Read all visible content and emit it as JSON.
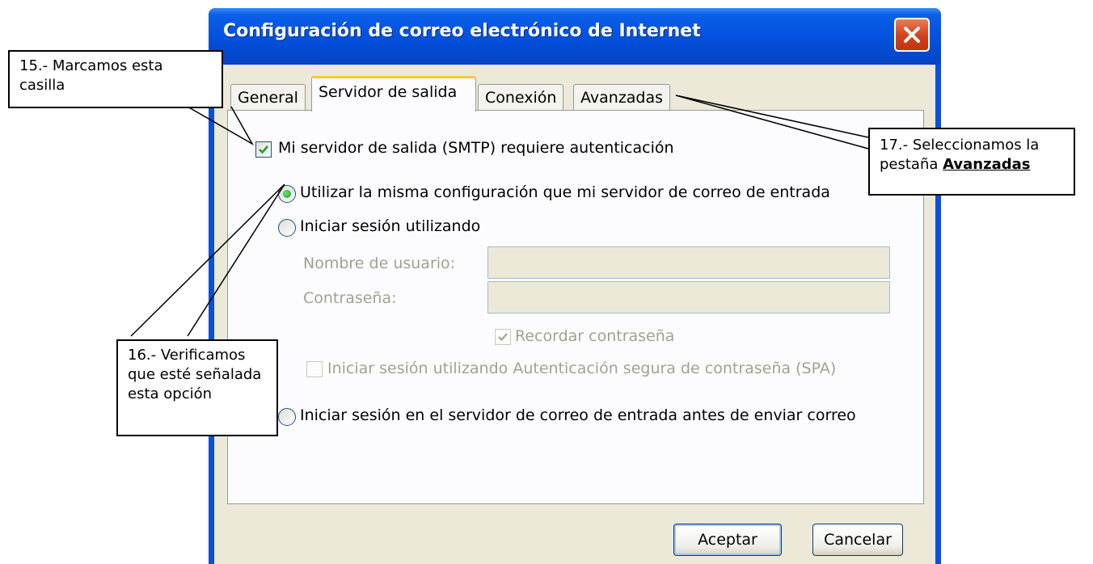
{
  "window": {
    "title": "Configuración de correo electrónico de Internet"
  },
  "tabs": [
    {
      "label": "General"
    },
    {
      "label": "Servidor de salida",
      "active": true
    },
    {
      "label": "Conexión"
    },
    {
      "label": "Avanzadas"
    }
  ],
  "smtp_auth": {
    "label": "Mi servidor de salida (SMTP) requiere autenticación",
    "checked": true
  },
  "options": {
    "same_config": {
      "label": "Utilizar la misma configuración que mi servidor de correo de entrada",
      "selected": true
    },
    "login_using": {
      "label": "Iniciar sesión utilizando",
      "selected": false
    },
    "login_before": {
      "label": "Iniciar sesión en el servidor de correo de entrada antes de enviar correo",
      "selected": false
    }
  },
  "fields": {
    "username_label": "Nombre de usuario:",
    "username_value": "",
    "password_label": "Contraseña:",
    "password_value": "",
    "remember_label": "Recordar contraseña",
    "remember_checked": true,
    "spa_label": "Iniciar sesión utilizando Autenticación segura de contraseña (SPA)",
    "spa_checked": false
  },
  "buttons": {
    "ok": "Aceptar",
    "cancel": "Cancelar"
  },
  "callouts": {
    "c15": "15.- Marcamos esta casilla",
    "c16": "16.- Verificamos que esté señalada esta opción",
    "c17_prefix": "17.- Seleccionamos la pestaña",
    "c17_bold": "Avanzadas"
  },
  "colors": {
    "titlebar": "#0553e0",
    "dialog_bg": "#ece9d8",
    "tab_highlight": "#ffc83c",
    "check_green": "#21a121"
  }
}
